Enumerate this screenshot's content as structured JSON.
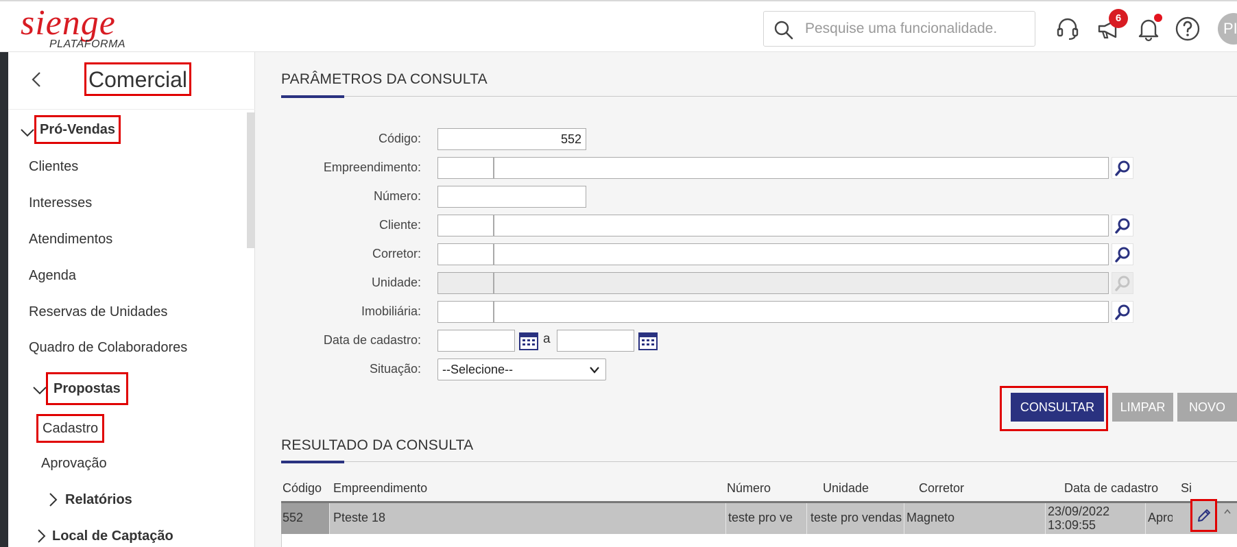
{
  "header": {
    "logo_text": "sienge",
    "logo_sub": "PLATAFORMA",
    "search_placeholder": "Pesquise uma funcionalidade.",
    "notifications_count": "6",
    "avatar_initials": "PI"
  },
  "sidebar": {
    "title": "Comercial",
    "group": "Pró-Vendas",
    "items": [
      "Clientes",
      "Interesses",
      "Atendimentos",
      "Agenda",
      "Reservas de Unidades",
      "Quadro de Colaboradores"
    ],
    "subgroup": "Propostas",
    "sub_items": [
      "Cadastro",
      "Aprovação"
    ],
    "relatorios": "Relatórios",
    "local": "Local de Captação"
  },
  "params": {
    "title": "PARÂMETROS DA CONSULTA",
    "codigo_label": "Código:",
    "codigo_value": "552",
    "empreendimento_label": "Empreendimento:",
    "numero_label": "Número:",
    "cliente_label": "Cliente:",
    "corretor_label": "Corretor:",
    "unidade_label": "Unidade:",
    "imobiliaria_label": "Imobiliária:",
    "data_label": "Data de cadastro:",
    "data_sep": "a",
    "situacao_label": "Situação:",
    "situacao_value": "--Selecione--"
  },
  "buttons": {
    "consultar": "CONSULTAR",
    "limpar": "LIMPAR",
    "novo": "NOVO"
  },
  "results": {
    "title": "RESULTADO DA CONSULTA",
    "columns": [
      "Código",
      "Empreendimento",
      "Número",
      "Unidade",
      "Corretor",
      "Data de cadastro",
      "Si"
    ],
    "row": {
      "codigo": "552",
      "empreendimento": "Pteste 18",
      "numero": "teste pro ve",
      "unidade": "teste pro vendas",
      "corretor": "Magneto",
      "data_line1": "23/09/2022",
      "data_line2": "13:09:55",
      "situacao": "Apro"
    }
  },
  "colors": {
    "brand": "#d81c23",
    "primary": "#2a3280",
    "highlight": "#e00000",
    "disabled_button": "#a8a8a8"
  }
}
